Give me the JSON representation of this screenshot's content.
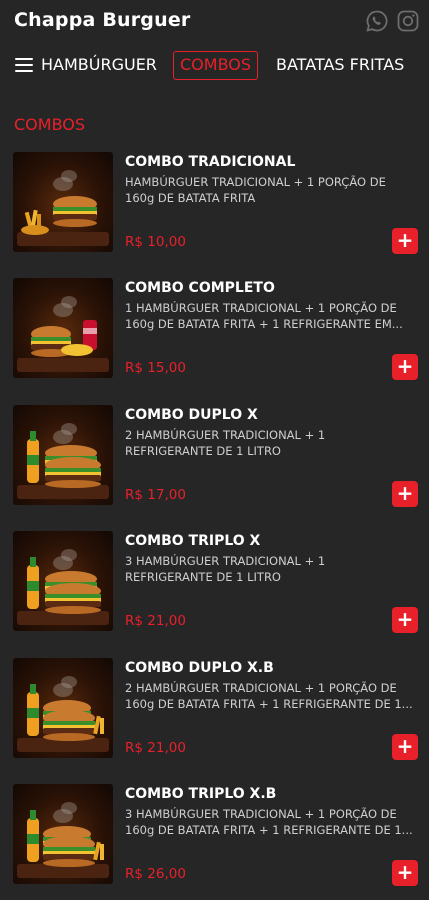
{
  "header": {
    "brand": "Chappa Burguer",
    "social": [
      {
        "icon": "whatsapp-icon"
      },
      {
        "icon": "instagram-icon"
      }
    ]
  },
  "nav": {
    "menu_icon": "hamburger-menu-icon",
    "tabs": [
      {
        "label": "HAMBÚRGUER",
        "active": false
      },
      {
        "label": "COMBOS",
        "active": true
      },
      {
        "label": "BATATAS FRITAS",
        "active": false
      }
    ]
  },
  "section": {
    "title": "COMBOS"
  },
  "items": [
    {
      "name": "COMBO TRADICIONAL",
      "desc": "HAMBÚRGUER TRADICIONAL + 1 PORÇÃO DE 160g DE BATATA FRITA",
      "price": "R$ 10,00",
      "add": "+"
    },
    {
      "name": "COMBO COMPLETO",
      "desc": "1 HAMBÚRGUER TRADICIONAL + 1 PORÇÃO DE 160g DE BATATA FRITA + 1 REFRIGERANTE EM...",
      "price": "R$ 15,00",
      "add": "+"
    },
    {
      "name": "COMBO DUPLO X",
      "desc": "2 HAMBÚRGUER TRADICIONAL + 1 REFRIGERANTE DE 1 LITRO",
      "price": "R$ 17,00",
      "add": "+"
    },
    {
      "name": "COMBO TRIPLO X",
      "desc": "3 HAMBÚRGUER TRADICIONAL + 1 REFRIGERANTE DE 1 LITRO",
      "price": "R$ 21,00",
      "add": "+"
    },
    {
      "name": "COMBO DUPLO X.B",
      "desc": "2 HAMBÚRGUER TRADICIONAL + 1 PORÇÃO DE 160g DE BATATA FRITA + 1 REFRIGERANTE DE 1...",
      "price": "R$ 21,00",
      "add": "+"
    },
    {
      "name": "COMBO TRIPLO X.B",
      "desc": "3 HAMBÚRGUER TRADICIONAL + 1 PORÇÃO DE 160g DE BATATA FRITA + 1 REFRIGERANTE DE 1...",
      "price": "R$ 26,00",
      "add": "+"
    }
  ],
  "colors": {
    "background": "#262626",
    "accent": "#e8202a",
    "text": "#ffffff",
    "muted_text": "#cfcfcf"
  }
}
